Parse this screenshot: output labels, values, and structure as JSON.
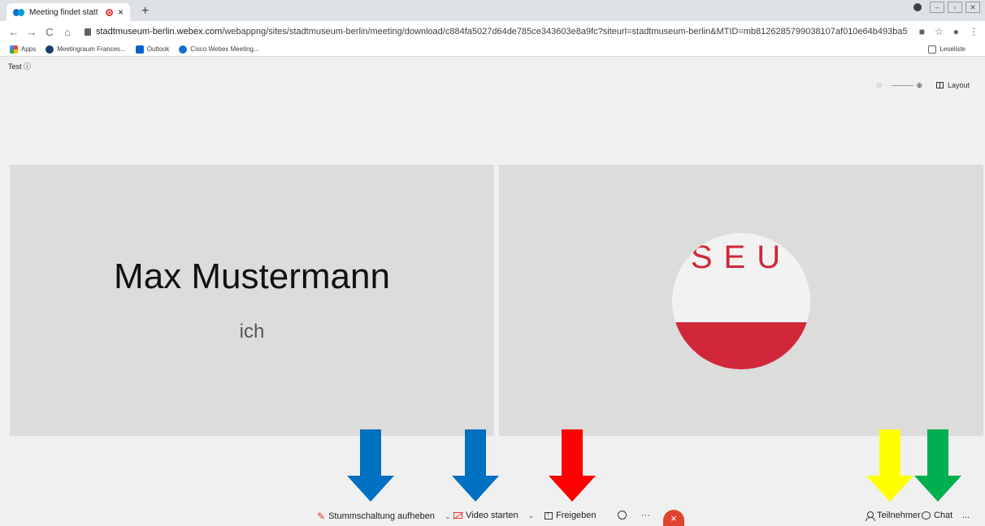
{
  "browser": {
    "tab_title": "Meeting findet statt ...",
    "tab_close": "×",
    "new_tab": "+",
    "url_host": "stadtmuseum-berlin.webex.com",
    "url_path": "/webappng/sites/stadtmuseum-berlin/meeting/download/c884fa5027d64de785ce343603e8a9fc?siteurl=stadtmuseum-berlin&MTID=mb8126285799038107af010e64b493ba5",
    "bookmarks": [
      {
        "label": "Apps",
        "icon": "apps-icon"
      },
      {
        "label": "Meetingraum Frances...",
        "icon": "site-icon"
      },
      {
        "label": "Outlook",
        "icon": "outlook-icon"
      },
      {
        "label": "Cisco Webex Meeting...",
        "icon": "webex-icon"
      }
    ],
    "reading_list": "Leseliste"
  },
  "meeting": {
    "title": "Test",
    "layout_label": "Layout",
    "participant_name": "Max Mustermann",
    "participant_sub": "ich",
    "avatar_text": "SEU"
  },
  "toolbar": {
    "unmute_label": "Stummschaltung aufheben",
    "video_label": "Video starten",
    "share_label": "Freigeben",
    "more_label": "···",
    "end_label": "×",
    "participants_label": "Teilnehmer",
    "chat_label": "Chat",
    "overflow_label": "..."
  },
  "arrows": [
    {
      "color": "#0070c0",
      "target": "unmute"
    },
    {
      "color": "#0070c0",
      "target": "video"
    },
    {
      "color": "#ff0000",
      "target": "share"
    },
    {
      "color": "#ffff00",
      "target": "participants"
    },
    {
      "color": "#00b050",
      "target": "chat"
    }
  ]
}
